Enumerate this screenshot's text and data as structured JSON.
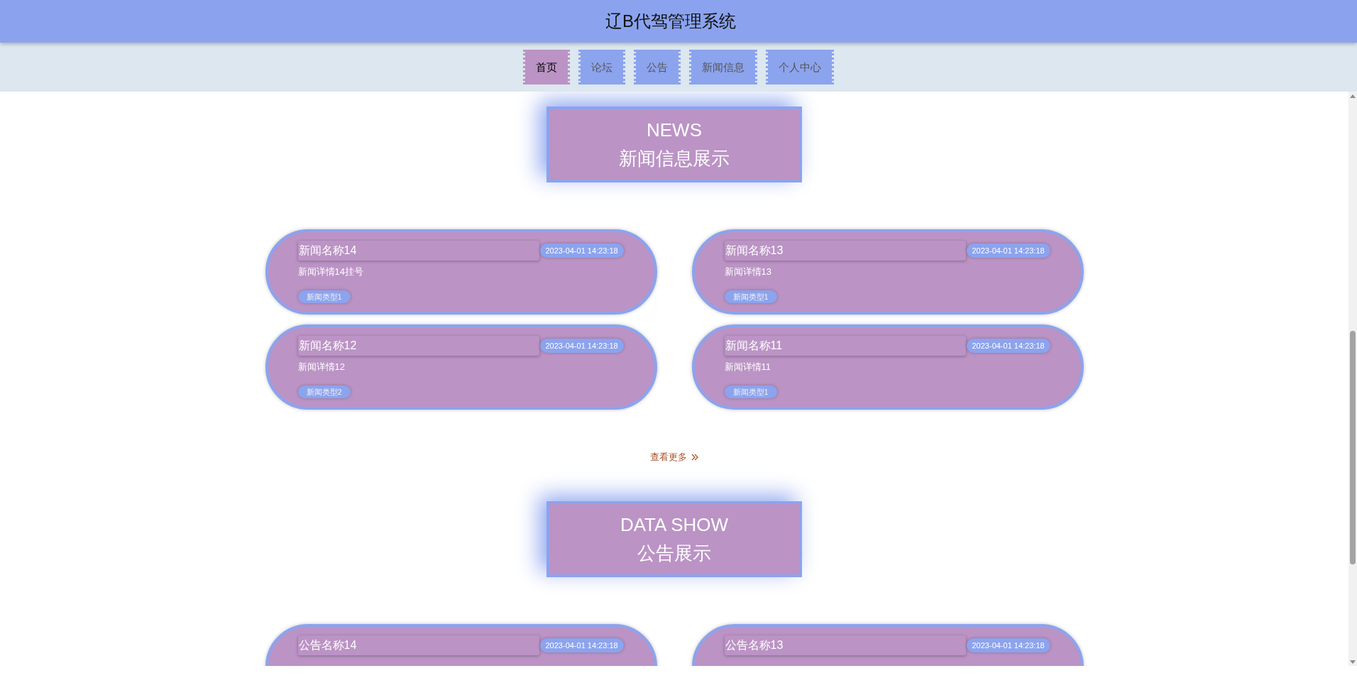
{
  "header": {
    "title": "辽B代驾管理系统"
  },
  "nav": [
    {
      "label": "首页",
      "selected": true
    },
    {
      "label": "论坛",
      "selected": false
    },
    {
      "label": "公告",
      "selected": false
    },
    {
      "label": "新闻信息",
      "selected": false
    },
    {
      "label": "个人中心",
      "selected": false
    }
  ],
  "sections": [
    {
      "heading_en": "NEWS",
      "heading": "新闻信息展示",
      "items": [
        {
          "title": "新闻名称14",
          "time": "2023-04-01 14:23:18",
          "detail": "新闻详情14挂号",
          "type": "新闻类型1"
        },
        {
          "title": "新闻名称13",
          "time": "2023-04-01 14:23:18",
          "detail": "新闻详情13",
          "type": "新闻类型1"
        },
        {
          "title": "新闻名称12",
          "time": "2023-04-01 14:23:18",
          "detail": "新闻详情12",
          "type": "新闻类型2"
        },
        {
          "title": "新闻名称11",
          "time": "2023-04-01 14:23:18",
          "detail": "新闻详情11",
          "type": "新闻类型1"
        }
      ],
      "more_link": "查看更多"
    },
    {
      "heading_en": "DATA SHOW",
      "heading": "公告展示",
      "items": [
        {
          "title": "公告名称14",
          "time": "2023-04-01 14:23:18"
        },
        {
          "title": "公告名称13",
          "time": "2023-04-01 14:23:18"
        }
      ]
    }
  ]
}
